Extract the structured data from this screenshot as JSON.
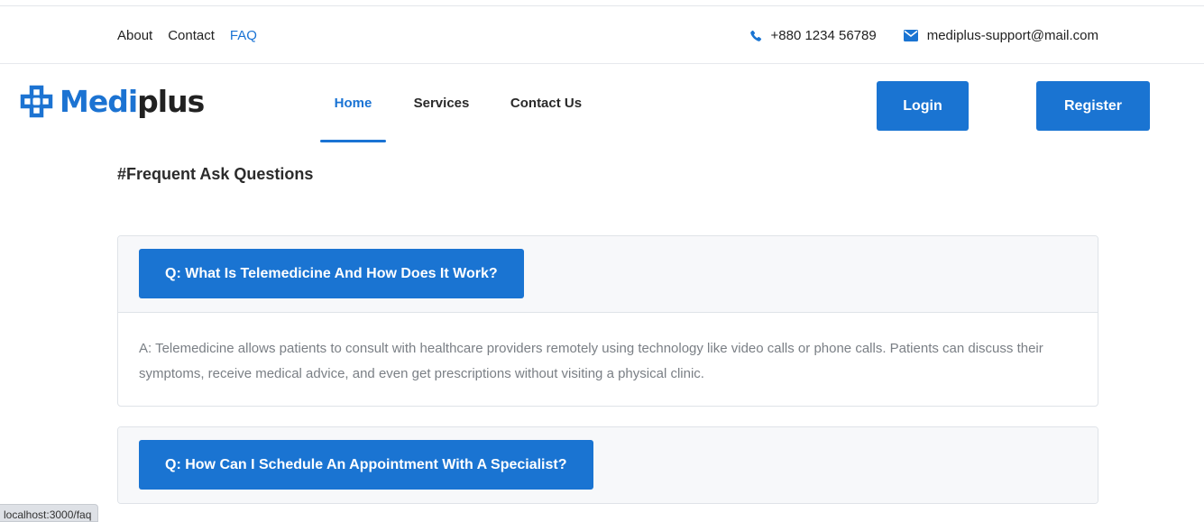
{
  "topbar": {
    "links": [
      {
        "label": "About"
      },
      {
        "label": "Contact"
      },
      {
        "label": "FAQ",
        "active": true
      }
    ],
    "phone": "+880 1234 56789",
    "email": "mediplus-support@mail.com"
  },
  "brand": {
    "name_part1": "Medi",
    "name_part2": "plus",
    "primary_color": "#1a74d2"
  },
  "nav": {
    "items": [
      {
        "label": "Home",
        "active": true
      },
      {
        "label": "Services"
      },
      {
        "label": "Contact Us"
      }
    ],
    "login_label": "Login",
    "register_label": "Register"
  },
  "faq": {
    "heading": "#Frequent Ask Questions",
    "items": [
      {
        "question": "Q: What Is Telemedicine And How Does It Work?",
        "answer": "A: Telemedicine allows patients to consult with healthcare providers remotely using technology like video calls or phone calls. Patients can discuss their symptoms, receive medical advice, and even get prescriptions without visiting a physical clinic."
      },
      {
        "question": "Q: How Can I Schedule An Appointment With A Specialist?"
      }
    ]
  },
  "statusbar": {
    "url": "localhost:3000/faq"
  }
}
